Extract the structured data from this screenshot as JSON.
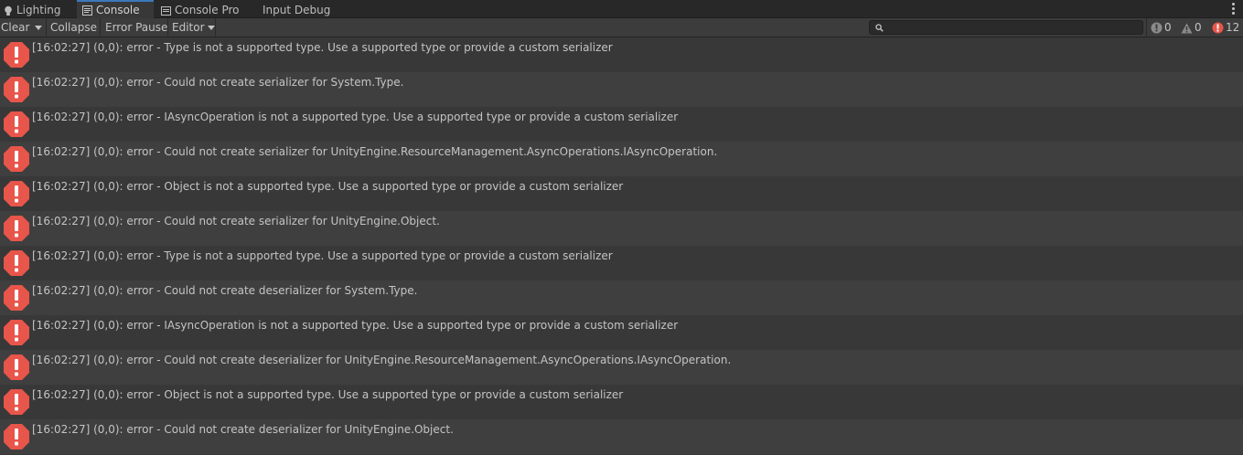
{
  "tabs": [
    {
      "label": "Lighting",
      "icon": "lightbulb-icon",
      "active": false
    },
    {
      "label": "Console",
      "icon": "console-icon",
      "active": true
    },
    {
      "label": "Console Pro",
      "icon": "console-pro-icon",
      "active": false
    },
    {
      "label": "Input Debug",
      "icon": "",
      "active": false
    }
  ],
  "toolbar": {
    "clear_label": "Clear",
    "collapse_label": "Collapse",
    "error_pause_label": "Error Pause",
    "editor_label": "Editor",
    "search_placeholder": "",
    "log_count": "0",
    "warning_count": "0",
    "error_count": "12"
  },
  "colors": {
    "error_icon": "#e8554a",
    "active_tab_accent": "#3a79bb"
  },
  "messages": [
    "[16:02:27] (0,0): error  - Type is not a supported type. Use a supported type or provide a custom serializer",
    "[16:02:27] (0,0): error  - Could not create serializer for System.Type.",
    "[16:02:27] (0,0): error  - IAsyncOperation is not a supported type. Use a supported type or provide a custom serializer",
    "[16:02:27] (0,0): error  - Could not create serializer for UnityEngine.ResourceManagement.AsyncOperations.IAsyncOperation.",
    "[16:02:27] (0,0): error  - Object is not a supported type. Use a supported type or provide a custom serializer",
    "[16:02:27] (0,0): error  - Could not create serializer for UnityEngine.Object.",
    "[16:02:27] (0,0): error  - Type is not a supported type. Use a supported type or provide a custom serializer",
    "[16:02:27] (0,0): error  - Could not create deserializer for System.Type.",
    "[16:02:27] (0,0): error  - IAsyncOperation is not a supported type. Use a supported type or provide a custom serializer",
    "[16:02:27] (0,0): error  - Could not create deserializer for UnityEngine.ResourceManagement.AsyncOperations.IAsyncOperation.",
    "[16:02:27] (0,0): error  - Object is not a supported type. Use a supported type or provide a custom serializer",
    "[16:02:27] (0,0): error  - Could not create deserializer for UnityEngine.Object."
  ]
}
